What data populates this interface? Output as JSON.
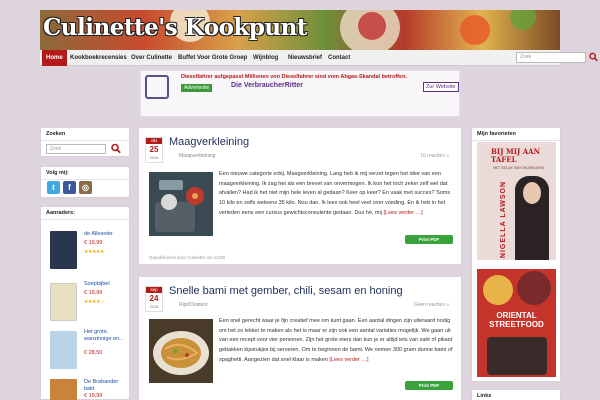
{
  "header": {
    "site_title": "Culinette's Kookpunt"
  },
  "nav": {
    "items": [
      "Home",
      "Kookboekrecensies",
      "Over Culinette",
      "Buffet Voor Grote Groep",
      "Wijnblog",
      "Nieuwsbrief",
      "Contact"
    ],
    "search_placeholder": "Zoek"
  },
  "ad": {
    "headline": "Dieselfahrer aufgepasst Millionen von Dieselfahrer sind vom Abgas-Skandal betroffen.",
    "tag": "Advertentie",
    "source": "Die VerbraucherRitter",
    "button": "Zur Website"
  },
  "sidebar_left": {
    "search_title": "Zoeken",
    "search_placeholder": "Zoek",
    "follow_title": "Volg mij:",
    "follow_icons": [
      "twitter-icon",
      "facebook-icon",
      "instagram-icon"
    ],
    "books_title": "Aanraders:",
    "books": [
      {
        "title": "de Alleseter",
        "price": "€ 19,99",
        "stars": "★★★★★",
        "color": "#2a3550"
      },
      {
        "title": "Soepbijbel",
        "price": "€ 19,99",
        "stars": "★★★★☆",
        "color": "#e8e0c0"
      },
      {
        "title": "Het grote, wanzinnige en...",
        "price": "€ 28,50",
        "stars": "",
        "color": "#b9d3e8"
      },
      {
        "title": "De Brabander bakt",
        "price": "€ 19,99",
        "stars": "",
        "color": "#c8843a"
      }
    ]
  },
  "posts": [
    {
      "month": "okt",
      "day": "25",
      "year": "2016",
      "title": "Maagverkleining",
      "category": "Maagverkleining",
      "reactions": "10 reacties »",
      "text": "Een nieuwe categorie erbij. Maagverkleining. Lang heb ik mij verzet tegen het idee van een maagverkleining. Ik zag het als een brevet van onvermogen. Ik kon het toch zeker zelf wel dat afvallen? Had ik het niet mijn hele leven al gedaan? Keer op keer? En vaak met succes? Soms 10 kilo en zelfs weleens 35 kilo. Nou dan. Ik lees ook heel veel over voeding. En ik heb in het verleden eens een cursus gewichtsconsulente gedaan. Dus hé, mij ",
      "more": "[Lees verder …]",
      "print": "Print  PDF",
      "footer": "Gepubliceerd door Culinette om 13:09"
    },
    {
      "month": "sep",
      "day": "24",
      "year": "2016",
      "title": "Snelle bami met gember, chili, sesam en honing",
      "category": "Rijst/Oosters",
      "reactions": "Geen reacties »",
      "text": "Een snel gerecht waar je fijn creatief mee om kunt gaan. Een aantal dingen zijn uiteraard nodig om het zo lekker te maken als het is maar er zijn ook een aantal variaties mogelijk. We gaan uit van een recept voor vier personen. Zijn het grote eters dan kun je er altijd iets van saté of pikant gebakken kipstukjes bij serveren. Om te beginnen de bami. We nemen 300 gram dunne bami of spaghetti. Aangezien dat snel klaar is maken ",
      "more": "[Lees verder …]",
      "print": "Print  PDF"
    }
  ],
  "sidebar_right": {
    "favorites_title": "Mijn favorieten",
    "book1_title": "BIJ MIJ AAN TAFEL",
    "book1_sub": "HET GELUK VAN THUISKOKEN",
    "book1_author": "NIGELLA LAWSON",
    "book2_title": "ORIENTAL STREETFOOD",
    "links_title": "Links"
  }
}
